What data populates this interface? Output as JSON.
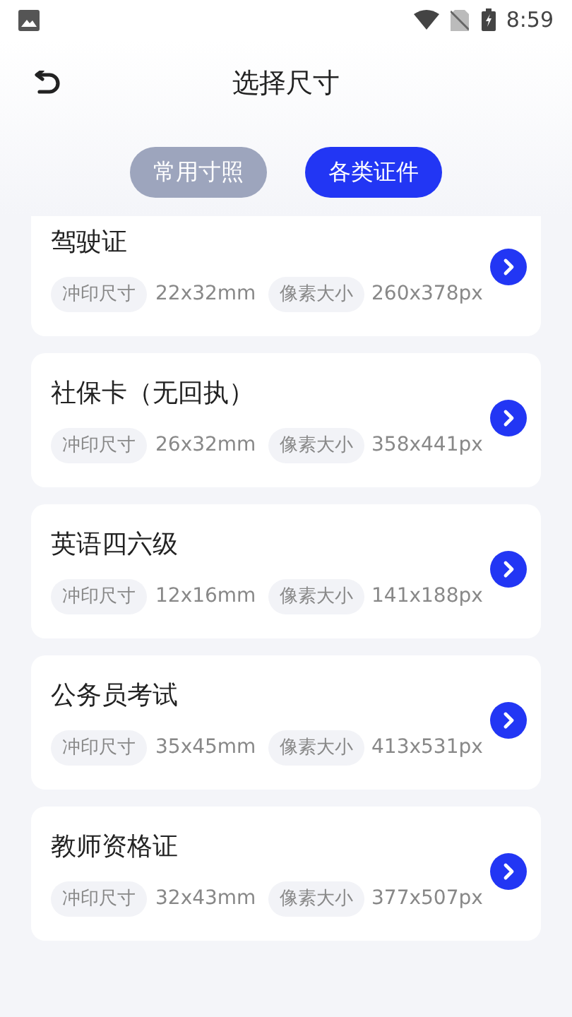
{
  "status_bar": {
    "time": "8:59"
  },
  "header": {
    "title": "选择尺寸"
  },
  "tabs": [
    {
      "label": "常用寸照",
      "selected": false
    },
    {
      "label": "各类证件",
      "selected": true
    }
  ],
  "items": [
    {
      "name": "驾驶证",
      "print_label": "冲印尺寸",
      "print_size": "22x32mm",
      "pixel_label": "像素大小",
      "pixel_size": "260x378px"
    },
    {
      "name": "社保卡（无回执）",
      "print_label": "冲印尺寸",
      "print_size": "26x32mm",
      "pixel_label": "像素大小",
      "pixel_size": "358x441px"
    },
    {
      "name": "英语四六级",
      "print_label": "冲印尺寸",
      "print_size": "12x16mm",
      "pixel_label": "像素大小",
      "pixel_size": "141x188px"
    },
    {
      "name": "公务员考试",
      "print_label": "冲印尺寸",
      "print_size": "35x45mm",
      "pixel_label": "像素大小",
      "pixel_size": "413x531px"
    },
    {
      "name": "教师资格证",
      "print_label": "冲印尺寸",
      "print_size": "32x43mm",
      "pixel_label": "像素大小",
      "pixel_size": "377x507px"
    }
  ]
}
